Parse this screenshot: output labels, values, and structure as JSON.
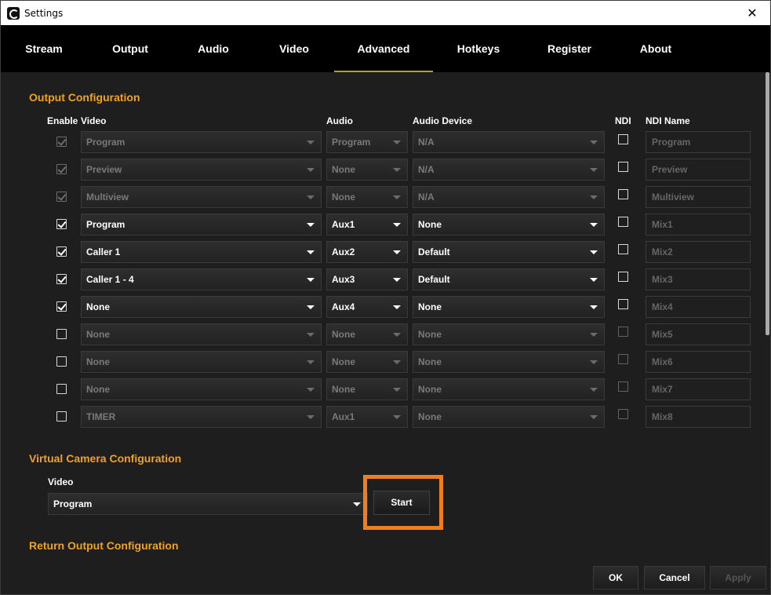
{
  "window": {
    "title": "Settings",
    "close_glyph": "✕"
  },
  "tabs": [
    {
      "label": "Stream"
    },
    {
      "label": "Output"
    },
    {
      "label": "Audio"
    },
    {
      "label": "Video"
    },
    {
      "label": "Advanced"
    },
    {
      "label": "Hotkeys"
    },
    {
      "label": "Register"
    },
    {
      "label": "About"
    }
  ],
  "active_tab": "Advanced",
  "output_config": {
    "title": "Output Configuration",
    "headers": {
      "enable": "Enable",
      "video": "Video",
      "audio": "Audio",
      "audio_device": "Audio Device",
      "ndi": "NDI",
      "ndi_name": "NDI Name"
    },
    "rows": [
      {
        "enabled": true,
        "locked": true,
        "video": "Program",
        "audio": "Program",
        "device": "N/A",
        "ndi": false,
        "ndi_name": "Program",
        "dim": true
      },
      {
        "enabled": true,
        "locked": true,
        "video": "Preview",
        "audio": "None",
        "device": "N/A",
        "ndi": false,
        "ndi_name": "Preview",
        "dim": true
      },
      {
        "enabled": true,
        "locked": true,
        "video": "Multiview",
        "audio": "None",
        "device": "N/A",
        "ndi": false,
        "ndi_name": "Multiview",
        "dim": true
      },
      {
        "enabled": true,
        "locked": false,
        "video": "Program",
        "audio": "Aux1",
        "device": "None",
        "ndi": false,
        "ndi_name": "Mix1",
        "dim": false
      },
      {
        "enabled": true,
        "locked": false,
        "video": "Caller 1",
        "audio": "Aux2",
        "device": "Default",
        "ndi": false,
        "ndi_name": "Mix2",
        "dim": false
      },
      {
        "enabled": true,
        "locked": false,
        "video": "Caller 1 - 4",
        "audio": "Aux3",
        "device": "Default",
        "ndi": false,
        "ndi_name": "Mix3",
        "dim": false
      },
      {
        "enabled": true,
        "locked": false,
        "video": "None",
        "audio": "Aux4",
        "device": "None",
        "ndi": false,
        "ndi_name": "Mix4",
        "dim": false
      },
      {
        "enabled": false,
        "locked": false,
        "video": "None",
        "audio": "None",
        "device": "None",
        "ndi": false,
        "ndi_name": "Mix5",
        "dim": true
      },
      {
        "enabled": false,
        "locked": false,
        "video": "None",
        "audio": "None",
        "device": "None",
        "ndi": false,
        "ndi_name": "Mix6",
        "dim": true
      },
      {
        "enabled": false,
        "locked": false,
        "video": "None",
        "audio": "None",
        "device": "None",
        "ndi": false,
        "ndi_name": "Mix7",
        "dim": true
      },
      {
        "enabled": false,
        "locked": false,
        "video": "TIMER",
        "audio": "Aux1",
        "device": "None",
        "ndi": false,
        "ndi_name": "Mix8",
        "dim": true
      }
    ]
  },
  "virtual_camera": {
    "title": "Virtual Camera Configuration",
    "video_label": "Video",
    "video_value": "Program",
    "start_label": "Start"
  },
  "return_output": {
    "title": "Return Output Configuration"
  },
  "footer": {
    "ok": "OK",
    "cancel": "Cancel",
    "apply": "Apply"
  },
  "colors": {
    "accent": "#f0a21f",
    "highlight": "#ef7d22",
    "tab_underline": "#a4a832"
  }
}
